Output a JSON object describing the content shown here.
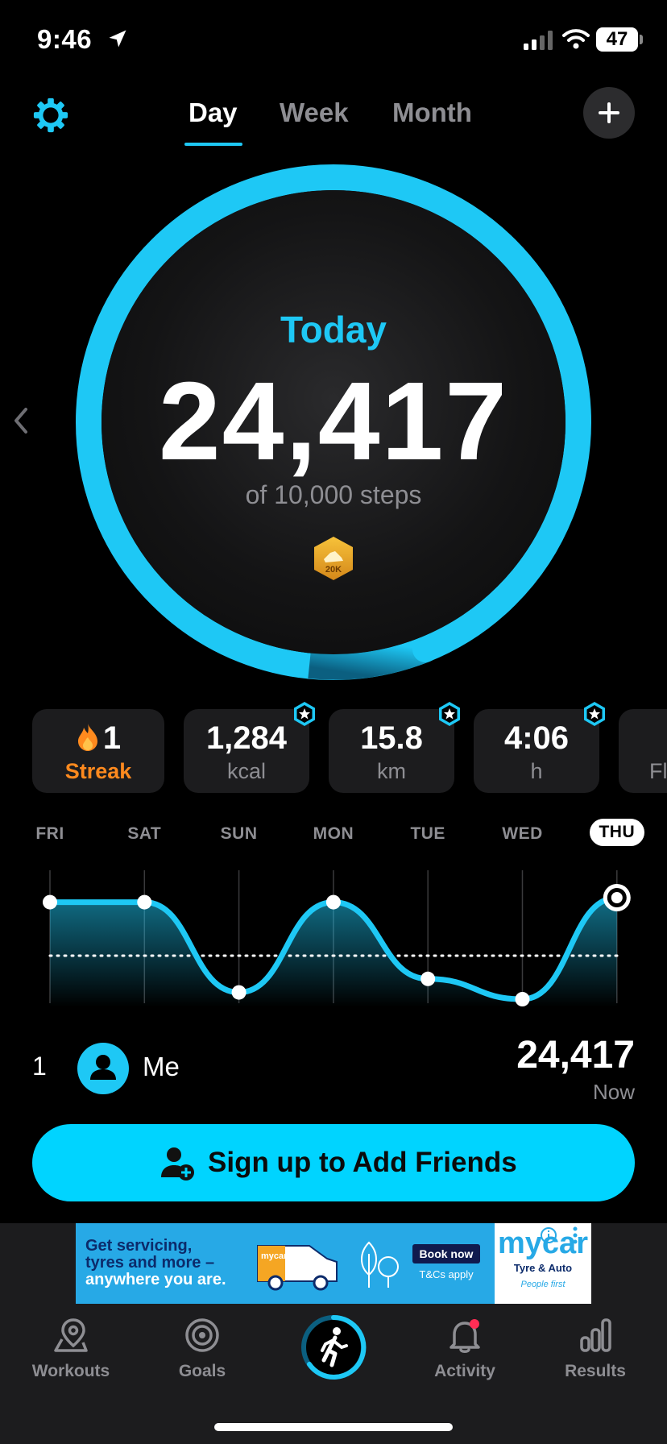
{
  "status_bar": {
    "time": "9:46",
    "battery": "47"
  },
  "tabs": [
    {
      "label": "Day",
      "active": true
    },
    {
      "label": "Week",
      "active": false
    },
    {
      "label": "Month",
      "active": false
    }
  ],
  "ring": {
    "label": "Today",
    "steps": "24,417",
    "goal_text": "of 10,000 steps",
    "badge": "20K",
    "progress": 1.0,
    "color": "#1ec8f5"
  },
  "stats": [
    {
      "value": "1",
      "unit": "Streak",
      "icon": "flame-icon"
    },
    {
      "value": "1,284",
      "unit": "kcal",
      "starred": true
    },
    {
      "value": "15.8",
      "unit": "km",
      "starred": true
    },
    {
      "value": "4:06",
      "unit": "h",
      "starred": true
    },
    {
      "value": "",
      "unit": "Fl"
    }
  ],
  "week": {
    "days": [
      "FRI",
      "SAT",
      "SUN",
      "MON",
      "TUE",
      "WED",
      "THU"
    ],
    "active_day": "THU",
    "relative_levels": [
      0.86,
      0.86,
      0.06,
      0.86,
      0.18,
      0.0,
      0.9
    ]
  },
  "leaderboard": {
    "rank": "1",
    "name": "Me",
    "steps": "24,417",
    "time": "Now"
  },
  "signup_button": {
    "label": "Sign up to Add Friends"
  },
  "ad": {
    "line1": "Get servicing,",
    "line2": "tyres and more –",
    "line3": "anywhere you are.",
    "van_text": "mycar to you",
    "book_label": "Book now",
    "terms": "T&Cs apply",
    "brand": "mycar",
    "tagline": "Tyre & Auto",
    "sub": "People first"
  },
  "tab_bar": [
    {
      "label": "Workouts",
      "icon": "map-pin-icon"
    },
    {
      "label": "Goals",
      "icon": "target-icon"
    },
    {
      "label": "",
      "icon": "walking-icon"
    },
    {
      "label": "Activity",
      "icon": "bell-icon"
    },
    {
      "label": "Results",
      "icon": "bar-chart-icon"
    }
  ],
  "colors": {
    "accent": "#1ec8f5",
    "streak": "#ff8a1e",
    "card": "#1c1c1e"
  }
}
